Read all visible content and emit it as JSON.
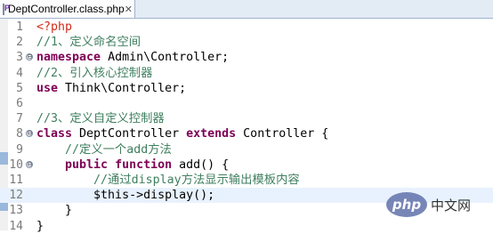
{
  "tab": {
    "label": "DeptController.class.php",
    "close": "✕"
  },
  "lines": [
    {
      "n": "1",
      "tokens": [
        [
          "ph",
          "<?php"
        ]
      ]
    },
    {
      "n": "2",
      "tokens": [
        [
          "cm",
          "//1、定义命名空间"
        ]
      ]
    },
    {
      "n": "3",
      "tokens": [
        [
          "kw",
          "namespace"
        ],
        [
          "",
          " Admin\\Controller;"
        ]
      ],
      "fold": "⊖"
    },
    {
      "n": "4",
      "tokens": [
        [
          "cm",
          "//2、引入核心控制器"
        ]
      ]
    },
    {
      "n": "5",
      "tokens": [
        [
          "kw",
          "use"
        ],
        [
          "",
          " Think\\Controller;"
        ]
      ]
    },
    {
      "n": "6",
      "tokens": []
    },
    {
      "n": "7",
      "tokens": [
        [
          "cm",
          "//3、定义自定义控制器"
        ]
      ]
    },
    {
      "n": "8",
      "tokens": [
        [
          "kw",
          "class"
        ],
        [
          "",
          " DeptController "
        ],
        [
          "kw",
          "extends"
        ],
        [
          "",
          " Controller {"
        ]
      ],
      "fold": "⊖"
    },
    {
      "n": "9",
      "tokens": [
        [
          "",
          "    "
        ],
        [
          "cm",
          "//定义一个add方法"
        ]
      ]
    },
    {
      "n": "10",
      "tokens": [
        [
          "",
          "    "
        ],
        [
          "kw",
          "public function"
        ],
        [
          "",
          " add() {"
        ]
      ],
      "fold": "⊖"
    },
    {
      "n": "11",
      "tokens": [
        [
          "",
          "        "
        ],
        [
          "cm",
          "//通过display方法显示输出模板内容"
        ]
      ]
    },
    {
      "n": "12",
      "tokens": [
        [
          "",
          "        $this->display();"
        ]
      ],
      "current": true
    },
    {
      "n": "13",
      "tokens": [
        [
          "",
          "    }"
        ]
      ]
    },
    {
      "n": "14",
      "tokens": [
        [
          "",
          "}"
        ]
      ]
    }
  ],
  "watermark": {
    "logo": "php",
    "text": "中文网"
  }
}
